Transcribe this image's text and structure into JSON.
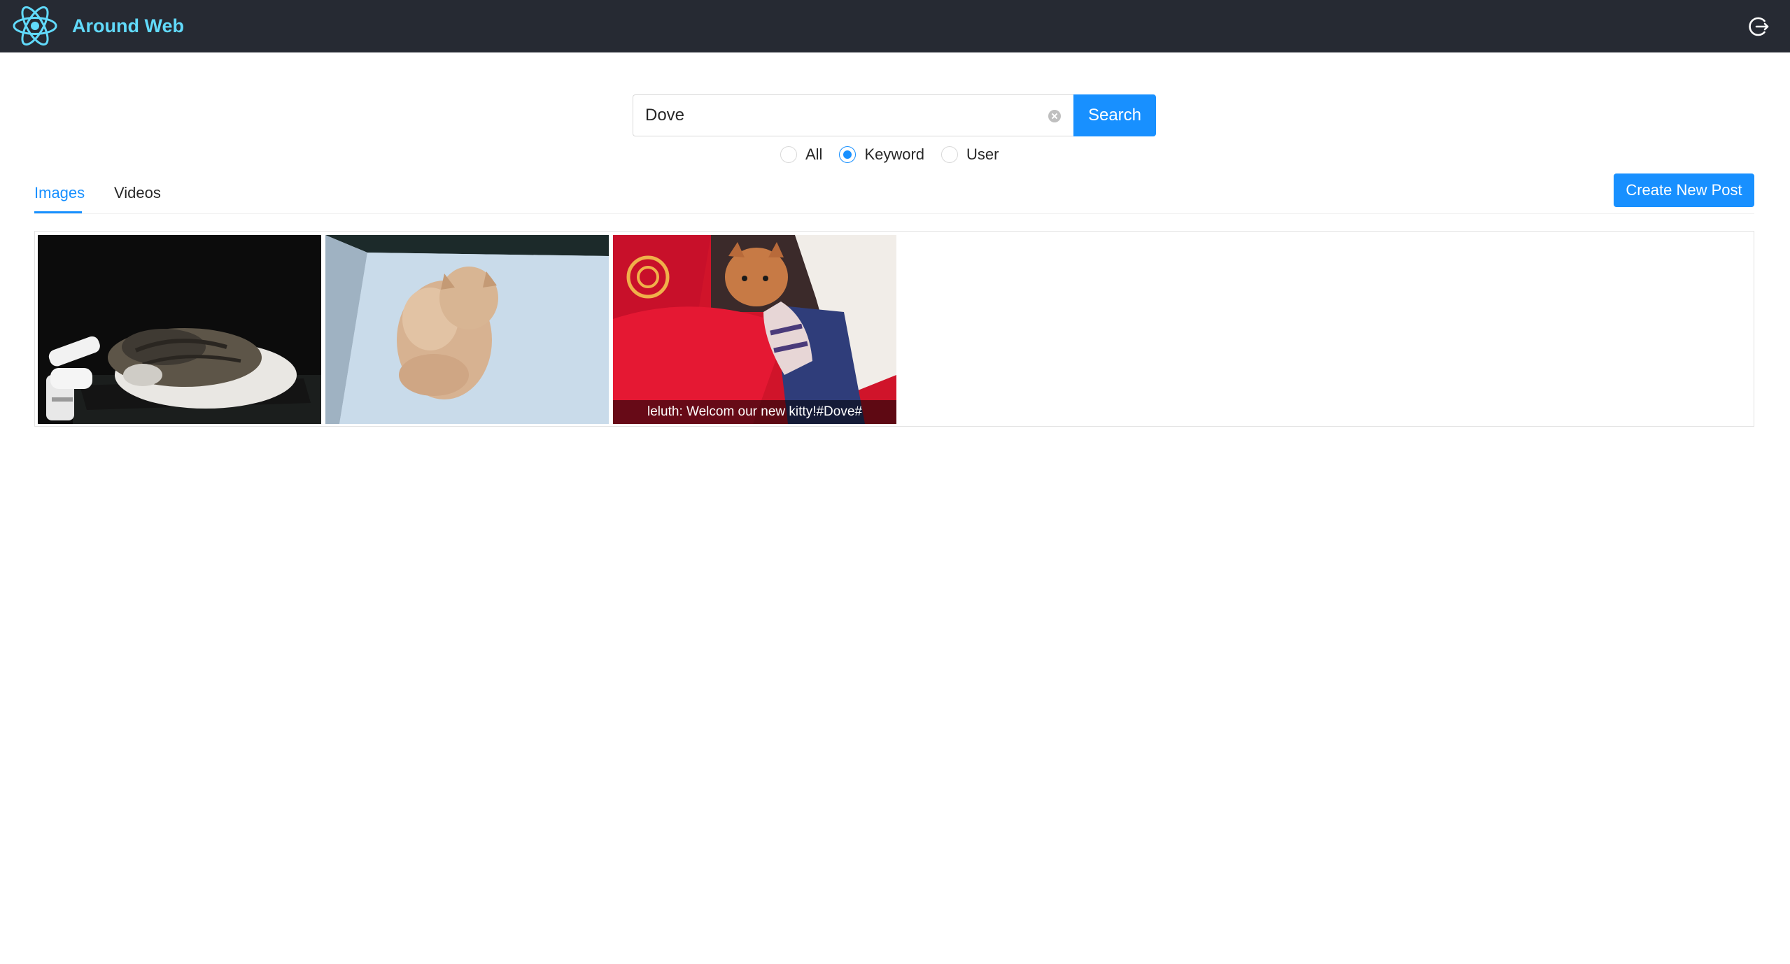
{
  "header": {
    "title": "Around Web",
    "logo_icon": "react-atom-icon",
    "logout_icon": "logout-icon",
    "background": "#262a33",
    "title_color": "#61dafb"
  },
  "search": {
    "value": "Dove",
    "button_label": "Search",
    "clear_icon": "close-circle-icon"
  },
  "search_type": {
    "options": [
      {
        "label": "All",
        "checked": false
      },
      {
        "label": "Keyword",
        "checked": true
      },
      {
        "label": "User",
        "checked": false
      }
    ]
  },
  "tabs": [
    {
      "label": "Images",
      "active": true
    },
    {
      "label": "Videos",
      "active": false
    }
  ],
  "create_post_label": "Create New Post",
  "gallery": {
    "items": [
      {
        "caption": ""
      },
      {
        "caption": ""
      },
      {
        "caption": "leluth: Welcom our new kitty!#Dove#"
      }
    ]
  },
  "colors": {
    "primary": "#1890ff"
  }
}
